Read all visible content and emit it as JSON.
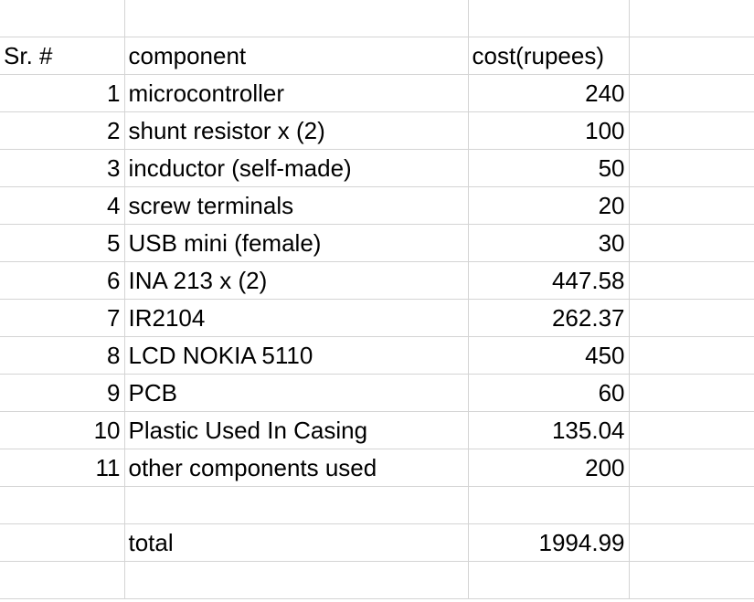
{
  "header": {
    "sr": "Sr. #",
    "component": "component",
    "cost": "cost(rupees)"
  },
  "rows": [
    {
      "sr": "1",
      "component": "microcontroller",
      "cost": "240"
    },
    {
      "sr": "2",
      "component": "shunt resistor x (2)",
      "cost": "100"
    },
    {
      "sr": "3",
      "component": "incductor (self-made)",
      "cost": "50"
    },
    {
      "sr": "4",
      "component": "screw terminals",
      "cost": "20"
    },
    {
      "sr": "5",
      "component": "USB mini (female)",
      "cost": "30"
    },
    {
      "sr": "6",
      "component": "INA 213 x (2)",
      "cost": "447.58"
    },
    {
      "sr": "7",
      "component": "IR2104",
      "cost": "262.37"
    },
    {
      "sr": "8",
      "component": "LCD NOKIA 5110",
      "cost": "450"
    },
    {
      "sr": "9",
      "component": "PCB",
      "cost": "60"
    },
    {
      "sr": "10",
      "component": "Plastic Used In Casing",
      "cost": "135.04"
    },
    {
      "sr": "11",
      "component": "other components used",
      "cost": "200"
    }
  ],
  "total": {
    "label": "total",
    "value": "1994.99"
  }
}
